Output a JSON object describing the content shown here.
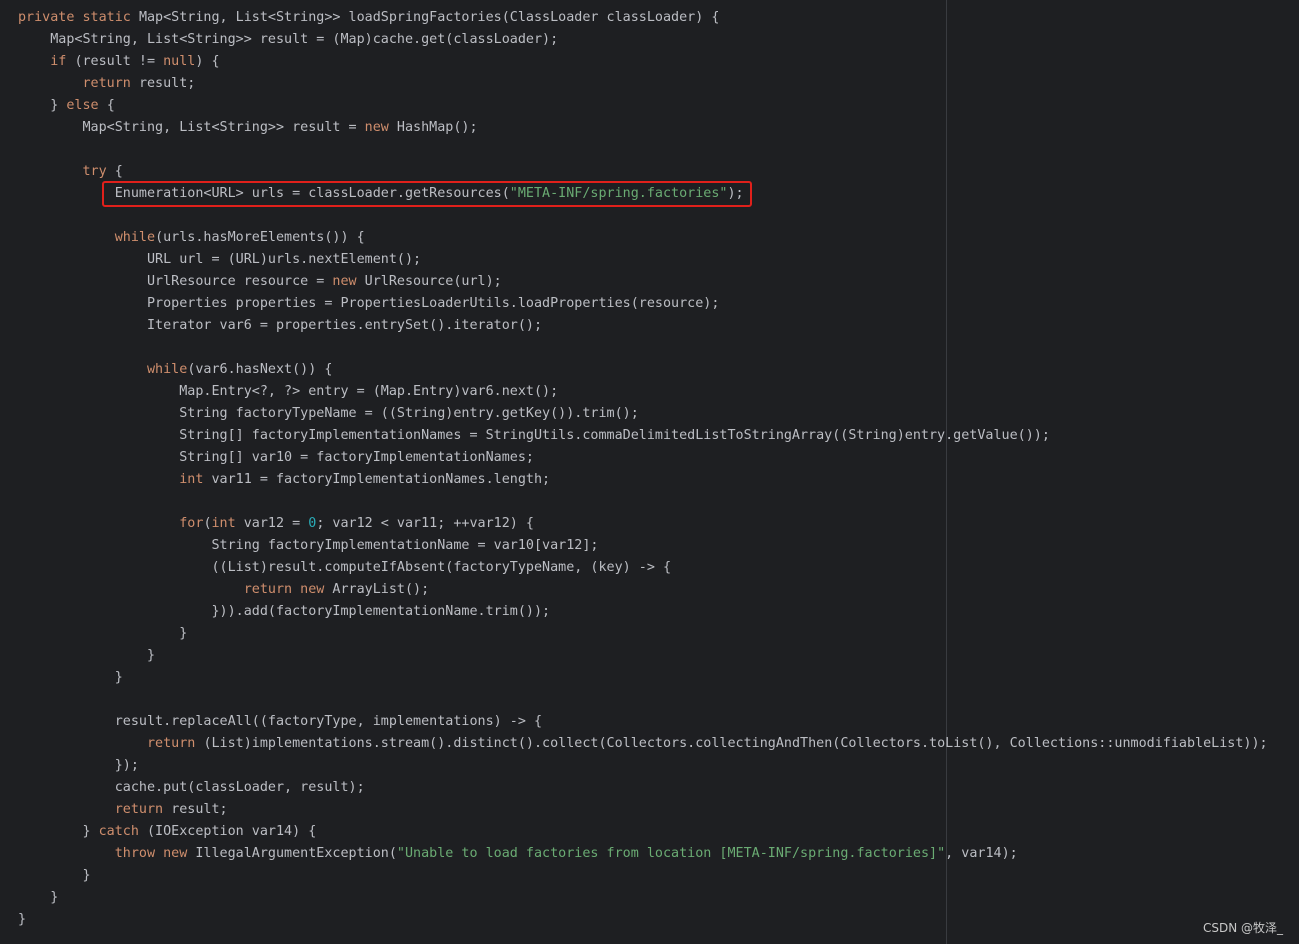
{
  "colors": {
    "background": "#1e1f22",
    "default_text": "#bcbec4",
    "keyword": "#cf8e6d",
    "string": "#6aab73",
    "number": "#2aacb8",
    "highlight_border": "#e0201b"
  },
  "watermark": "CSDN @牧泽_",
  "code_lines": [
    [
      [
        "kw",
        "private static "
      ],
      [
        "t",
        "Map<String, List<String>> loadSpringFactories(ClassLoader classLoader) {"
      ]
    ],
    [
      [
        "t",
        "    Map<String, List<String>> result = (Map)cache.get(classLoader);"
      ]
    ],
    [
      [
        "kw",
        "    if "
      ],
      [
        "t",
        "(result != "
      ],
      [
        "kw",
        "null"
      ],
      [
        "t",
        ") {"
      ]
    ],
    [
      [
        "kw",
        "        return "
      ],
      [
        "t",
        "result;"
      ]
    ],
    [
      [
        "t",
        "    } "
      ],
      [
        "kw",
        "else "
      ],
      [
        "t",
        "{"
      ]
    ],
    [
      [
        "t",
        "        Map<String, List<String>> result = "
      ],
      [
        "kw",
        "new "
      ],
      [
        "t",
        "HashMap();"
      ]
    ],
    [
      [
        "t",
        ""
      ]
    ],
    [
      [
        "kw",
        "        try "
      ],
      [
        "t",
        "{"
      ]
    ],
    [
      [
        "t",
        "            Enumeration<URL> urls = classLoader.getResources("
      ],
      [
        "str",
        "\"META-INF/spring.factories\""
      ],
      [
        "t",
        ");"
      ]
    ],
    [
      [
        "t",
        ""
      ]
    ],
    [
      [
        "kw",
        "            while"
      ],
      [
        "t",
        "(urls.hasMoreElements()) {"
      ]
    ],
    [
      [
        "t",
        "                URL url = (URL)urls.nextElement();"
      ]
    ],
    [
      [
        "t",
        "                UrlResource resource = "
      ],
      [
        "kw",
        "new "
      ],
      [
        "t",
        "UrlResource(url);"
      ]
    ],
    [
      [
        "t",
        "                Properties properties = PropertiesLoaderUtils.loadProperties(resource);"
      ]
    ],
    [
      [
        "t",
        "                Iterator var6 = properties.entrySet().iterator();"
      ]
    ],
    [
      [
        "t",
        ""
      ]
    ],
    [
      [
        "kw",
        "                while"
      ],
      [
        "t",
        "(var6.hasNext()) {"
      ]
    ],
    [
      [
        "t",
        "                    Map.Entry<?, ?> entry = (Map.Entry)var6.next();"
      ]
    ],
    [
      [
        "t",
        "                    String factoryTypeName = ((String)entry.getKey()).trim();"
      ]
    ],
    [
      [
        "t",
        "                    String[] factoryImplementationNames = StringUtils.commaDelimitedListToStringArray((String)entry.getValue());"
      ]
    ],
    [
      [
        "t",
        "                    String[] var10 = factoryImplementationNames;"
      ]
    ],
    [
      [
        "kw",
        "                    int "
      ],
      [
        "t",
        "var11 = factoryImplementationNames.length;"
      ]
    ],
    [
      [
        "t",
        ""
      ]
    ],
    [
      [
        "kw",
        "                    for"
      ],
      [
        "t",
        "("
      ],
      [
        "kw",
        "int "
      ],
      [
        "t",
        "var12 = "
      ],
      [
        "num",
        "0"
      ],
      [
        "t",
        "; var12 < var11; ++var12) {"
      ]
    ],
    [
      [
        "t",
        "                        String factoryImplementationName = var10[var12];"
      ]
    ],
    [
      [
        "t",
        "                        ((List)result.computeIfAbsent(factoryTypeName, (key) -> {"
      ]
    ],
    [
      [
        "kw",
        "                            return new "
      ],
      [
        "t",
        "ArrayList();"
      ]
    ],
    [
      [
        "t",
        "                        })).add(factoryImplementationName.trim());"
      ]
    ],
    [
      [
        "t",
        "                    }"
      ]
    ],
    [
      [
        "t",
        "                }"
      ]
    ],
    [
      [
        "t",
        "            }"
      ]
    ],
    [
      [
        "t",
        ""
      ]
    ],
    [
      [
        "t",
        "            result.replaceAll((factoryType, implementations) -> {"
      ]
    ],
    [
      [
        "kw",
        "                return "
      ],
      [
        "t",
        "(List)implementations.stream().distinct().collect(Collectors.collectingAndThen(Collectors.toList(), Collections::unmodifiableList));"
      ]
    ],
    [
      [
        "t",
        "            });"
      ]
    ],
    [
      [
        "t",
        "            cache.put(classLoader, result);"
      ]
    ],
    [
      [
        "kw",
        "            return "
      ],
      [
        "t",
        "result;"
      ]
    ],
    [
      [
        "t",
        "        } "
      ],
      [
        "kw",
        "catch "
      ],
      [
        "t",
        "(IOException var14) {"
      ]
    ],
    [
      [
        "kw",
        "            throw new "
      ],
      [
        "t",
        "IllegalArgumentException("
      ],
      [
        "str",
        "\"Unable to load factories from location [META-INF/spring.factories]\""
      ],
      [
        "t",
        ", var14);"
      ]
    ],
    [
      [
        "t",
        "        }"
      ]
    ],
    [
      [
        "t",
        "    }"
      ]
    ],
    [
      [
        "t",
        "}"
      ]
    ]
  ]
}
